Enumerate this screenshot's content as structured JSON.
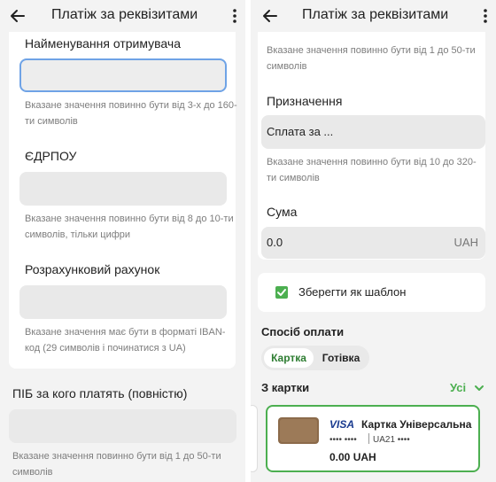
{
  "left": {
    "title": "Платіж за реквізитами",
    "recipient_name": {
      "label": "Найменування отримувача",
      "value": "",
      "hint": "Вказане значення повинно бути від 3-х до 160-ти символів"
    },
    "edrpou": {
      "label": "ЄДРПОУ",
      "value": "",
      "hint": "Вказане значення повинно бути від 8 до 10-ти символів, тільки цифри"
    },
    "account": {
      "label": "Розрахунковий рахунок",
      "value": "",
      "hint": "Вказане значення має бути в форматі IBAN-код (29 символів і починатися з UA)"
    },
    "payer_name": {
      "label": "ПІБ за кого платять (повністю)",
      "value": "",
      "hint": "Вказане значення повинно бути від 1 до 50-ти символів"
    }
  },
  "right": {
    "title": "Платіж за реквізитами",
    "top_hint": "Вказане значення повинно бути від 1 до 50-ти символів",
    "purpose": {
      "label": "Призначення",
      "value": "Сплата за ...",
      "hint": "Вказане значення повинно бути від 10 до 320-ти символів"
    },
    "amount": {
      "label": "Сума",
      "value": "0.0",
      "currency": "UAH"
    },
    "save_template": {
      "label": "Зберегти як шаблон",
      "checked": true
    },
    "payment_method": {
      "title": "Спосіб оплати",
      "tabs": [
        {
          "label": "Картка",
          "active": true
        },
        {
          "label": "Готівка",
          "active": false
        }
      ]
    },
    "cards_section": {
      "title": "З картки",
      "all_label": "Усі"
    },
    "card": {
      "brand": "VISA",
      "name": "Картка Універсальна",
      "masked_number": "•••• ••••",
      "iban": "UA21 ••••",
      "balance": "0.00 UAH"
    }
  },
  "colors": {
    "accent": "#4caf50",
    "focus": "#6fa3e6",
    "field_bg": "#e9e9e9",
    "background": "#f3f3f3"
  }
}
